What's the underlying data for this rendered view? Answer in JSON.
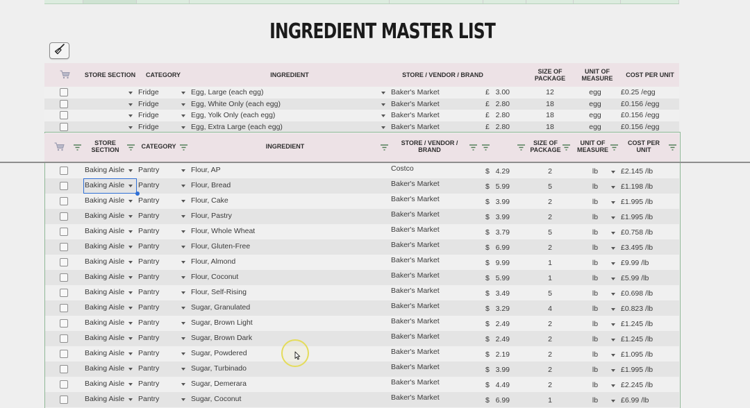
{
  "title": "INGREDIENT MASTER LIST",
  "colors": {
    "header_bg": "#ede2e6",
    "frame": "#8fb796",
    "selection": "#2f6fd6"
  },
  "toolbar": {
    "clear_icon": "broom-icon"
  },
  "header1": {
    "store_section": "STORE SECTION",
    "category": "CATEGORY",
    "ingredient": "INGREDIENT",
    "vendor": "STORE / VENDOR / BRAND",
    "size": [
      "SIZE OF",
      "PACKAGE"
    ],
    "unit": [
      "UNIT OF",
      "MEASURE"
    ],
    "cost": "COST PER UNIT"
  },
  "header2": {
    "store_section": [
      "STORE",
      "SECTION"
    ],
    "category": "CATEGORY",
    "ingredient": "INGREDIENT",
    "vendor": [
      "STORE / VENDOR /",
      "BRAND"
    ],
    "size": [
      "SIZE OF",
      "PACKAGE"
    ],
    "unit": [
      "UNIT OF",
      "MEASURE"
    ],
    "cost": [
      "COST PER",
      "UNIT"
    ]
  },
  "frozen_rows": [
    {
      "section": "",
      "category": "Fridge",
      "ingredient": "Egg, Large (each egg)",
      "vendor": "Baker's Market",
      "currency": "£",
      "price": "3.00",
      "size": "12",
      "unit": "egg",
      "cost": "£0.25 /egg"
    },
    {
      "section": "",
      "category": "Fridge",
      "ingredient": "Egg, White Only (each egg)",
      "vendor": "Baker's Market",
      "currency": "£",
      "price": "2.80",
      "size": "18",
      "unit": "egg",
      "cost": "£0.156 /egg"
    },
    {
      "section": "",
      "category": "Fridge",
      "ingredient": "Egg, Yolk Only (each egg)",
      "vendor": "Baker's Market",
      "currency": "£",
      "price": "2.80",
      "size": "18",
      "unit": "egg",
      "cost": "£0.156 /egg"
    },
    {
      "section": "",
      "category": "Fridge",
      "ingredient": "Egg, Extra Large (each egg)",
      "vendor": "Baker's Market",
      "currency": "£",
      "price": "2.80",
      "size": "18",
      "unit": "egg",
      "cost": "£0.156 /egg"
    }
  ],
  "rows": [
    {
      "section": "Baking Aisle",
      "category": "Pantry",
      "ingredient": "Flour, AP",
      "vendor": "Costco",
      "currency": "$",
      "price": "4.29",
      "size": "2",
      "unit": "lb",
      "cost": "£2.145 /lb"
    },
    {
      "section": "Baking Aisle",
      "category": "Pantry",
      "ingredient": "Flour, Bread",
      "vendor": "Baker's Market",
      "currency": "$",
      "price": "5.99",
      "size": "5",
      "unit": "lb",
      "cost": "£1.198 /lb"
    },
    {
      "section": "Baking Aisle",
      "category": "Pantry",
      "ingredient": "Flour, Cake",
      "vendor": "Baker's Market",
      "currency": "$",
      "price": "3.99",
      "size": "2",
      "unit": "lb",
      "cost": "£1.995 /lb"
    },
    {
      "section": "Baking Aisle",
      "category": "Pantry",
      "ingredient": "Flour, Pastry",
      "vendor": "Baker's Market",
      "currency": "$",
      "price": "3.99",
      "size": "2",
      "unit": "lb",
      "cost": "£1.995 /lb"
    },
    {
      "section": "Baking Aisle",
      "category": "Pantry",
      "ingredient": "Flour, Whole Wheat",
      "vendor": "Baker's Market",
      "currency": "$",
      "price": "3.79",
      "size": "5",
      "unit": "lb",
      "cost": "£0.758 /lb"
    },
    {
      "section": "Baking Aisle",
      "category": "Pantry",
      "ingredient": "Flour, Gluten-Free",
      "vendor": "Baker's Market",
      "currency": "$",
      "price": "6.99",
      "size": "2",
      "unit": "lb",
      "cost": "£3.495 /lb"
    },
    {
      "section": "Baking Aisle",
      "category": "Pantry",
      "ingredient": "Flour, Almond",
      "vendor": "Baker's Market",
      "currency": "$",
      "price": "9.99",
      "size": "1",
      "unit": "lb",
      "cost": "£9.99 /lb"
    },
    {
      "section": "Baking Aisle",
      "category": "Pantry",
      "ingredient": "Flour, Coconut",
      "vendor": "Baker's Market",
      "currency": "$",
      "price": "5.99",
      "size": "1",
      "unit": "lb",
      "cost": "£5.99 /lb"
    },
    {
      "section": "Baking Aisle",
      "category": "Pantry",
      "ingredient": "Flour, Self-Rising",
      "vendor": "Baker's Market",
      "currency": "$",
      "price": "3.49",
      "size": "5",
      "unit": "lb",
      "cost": "£0.698 /lb"
    },
    {
      "section": "Baking Aisle",
      "category": "Pantry",
      "ingredient": "Sugar, Granulated",
      "vendor": "Baker's Market",
      "currency": "$",
      "price": "3.29",
      "size": "4",
      "unit": "lb",
      "cost": "£0.823 /lb"
    },
    {
      "section": "Baking Aisle",
      "category": "Pantry",
      "ingredient": "Sugar, Brown Light",
      "vendor": "Baker's Market",
      "currency": "$",
      "price": "2.49",
      "size": "2",
      "unit": "lb",
      "cost": "£1.245 /lb"
    },
    {
      "section": "Baking Aisle",
      "category": "Pantry",
      "ingredient": "Sugar, Brown Dark",
      "vendor": "Baker's Market",
      "currency": "$",
      "price": "2.49",
      "size": "2",
      "unit": "lb",
      "cost": "£1.245 /lb"
    },
    {
      "section": "Baking Aisle",
      "category": "Pantry",
      "ingredient": "Sugar, Powdered",
      "vendor": "Baker's Market",
      "currency": "$",
      "price": "2.19",
      "size": "2",
      "unit": "lb",
      "cost": "£1.095 /lb"
    },
    {
      "section": "Baking Aisle",
      "category": "Pantry",
      "ingredient": "Sugar, Turbinado",
      "vendor": "Baker's Market",
      "currency": "$",
      "price": "3.99",
      "size": "2",
      "unit": "lb",
      "cost": "£1.995 /lb"
    },
    {
      "section": "Baking Aisle",
      "category": "Pantry",
      "ingredient": "Sugar, Demerara",
      "vendor": "Baker's Market",
      "currency": "$",
      "price": "4.49",
      "size": "2",
      "unit": "lb",
      "cost": "£2.245 /lb"
    },
    {
      "section": "Baking Aisle",
      "category": "Pantry",
      "ingredient": "Sugar, Coconut",
      "vendor": "Baker's Market",
      "currency": "$",
      "price": "6.99",
      "size": "1",
      "unit": "lb",
      "cost": "£6.99 /lb"
    }
  ]
}
